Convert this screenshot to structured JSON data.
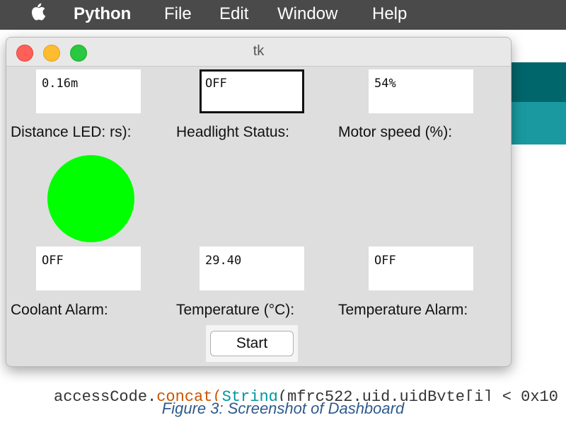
{
  "menubar": {
    "apple_icon": "apple-logo",
    "items": [
      "Python",
      "File",
      "Edit",
      "Window",
      "Help"
    ]
  },
  "background": {
    "code_prefix": "accessCode.",
    "code_method": "concat(",
    "code_class": "String",
    "code_rest": "(mfrc522.uid.uidByte[i] < 0x10"
  },
  "window": {
    "title": "tk",
    "fields": {
      "distance": "0.16m",
      "headlight": "OFF",
      "motor_speed": "54%",
      "coolant": "OFF",
      "temperature": "29.40",
      "temp_alarm": "OFF"
    },
    "labels": {
      "distance": "Distance LED:",
      "distance_tail": "rs):",
      "headlight": "Headlight Status:",
      "motor_speed": "Motor speed (%):",
      "coolant": "Coolant Alarm:",
      "temperature": "Temperature (°C):",
      "temp_alarm": "Temperature Alarm:"
    },
    "led_color": "#00ff00",
    "start_label": "Start"
  },
  "caption": "Figure 3: Screenshot of Dashboard"
}
